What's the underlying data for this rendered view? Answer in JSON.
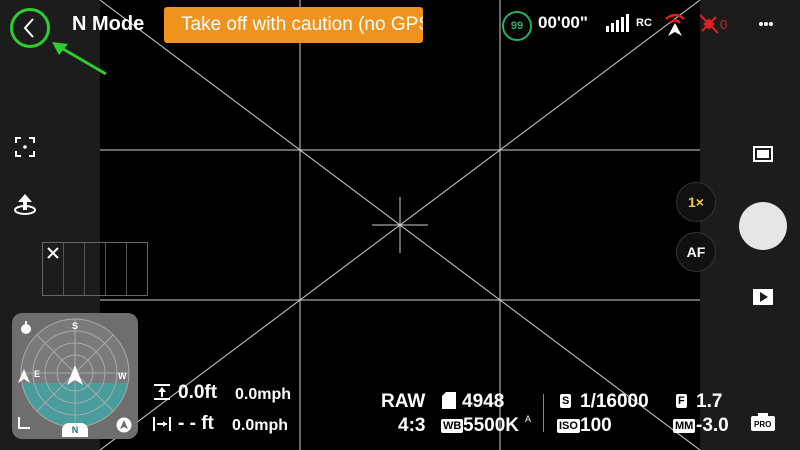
{
  "top": {
    "mode": "N Mode",
    "banner": "Take off with caution (no GPS)",
    "battery": "99",
    "flight_time": "00'00\"",
    "rc_label": "RC",
    "drone_count": "0"
  },
  "right": {
    "zoom": "1×",
    "af": "AF",
    "pro": "PRO"
  },
  "compass": {
    "north": "S",
    "east": "E",
    "west": "W",
    "badge": "N"
  },
  "telemetry": {
    "height": "0.0ft",
    "vspeed": "0.0mph",
    "distance": "- - ft",
    "hspeed": "0.0mph"
  },
  "camera": {
    "format": "RAW",
    "ratio": "4:3",
    "storage_icon_label": "",
    "storage": "4948",
    "wb_tag": "WB",
    "wb": "5500K",
    "shutter_tag": "S",
    "shutter": "1/16000",
    "iso_tag": "ISO",
    "iso": "100",
    "aperture_tag": "F",
    "aperture": "1.7",
    "ev_tag": "MM",
    "ev": "-3.0"
  },
  "colors": {
    "accent_green": "#2ecc2e",
    "banner_orange": "#f0931e",
    "battery_green": "#1fb36a",
    "warning_red": "#e02020"
  }
}
